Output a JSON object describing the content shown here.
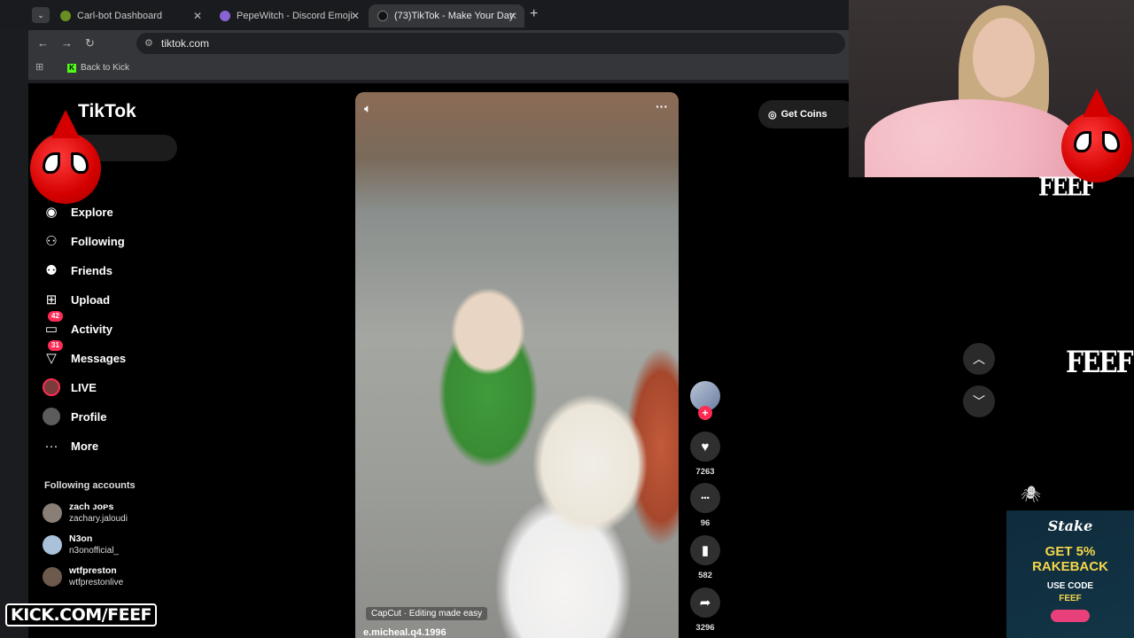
{
  "browser": {
    "tabs": [
      {
        "title": "Carl-bot Dashboard",
        "fav_color": "#6b8e23"
      },
      {
        "title": "PepeWitch - Discord Emoji",
        "fav_color": "#8a63d2"
      },
      {
        "title": "(73)TikTok - Make Your Day",
        "fav_color": "#111111"
      }
    ],
    "new_tab": "+",
    "tab_close": "✕",
    "url": "tiktok.com",
    "bookmark": "Back to Kick"
  },
  "tiktok": {
    "logo": "TikTok",
    "nav": [
      {
        "label": "Explore",
        "icon": "compass-icon",
        "glyph": "◉"
      },
      {
        "label": "Following",
        "icon": "following-icon",
        "glyph": "⚇"
      },
      {
        "label": "Friends",
        "icon": "friends-icon",
        "glyph": "⚉"
      },
      {
        "label": "Upload",
        "icon": "upload-icon",
        "glyph": "⊞"
      },
      {
        "label": "Activity",
        "icon": "activity-icon",
        "glyph": "▭",
        "badge": "42"
      },
      {
        "label": "Messages",
        "icon": "messages-icon",
        "glyph": "▽",
        "badge": "31"
      },
      {
        "label": "LIVE",
        "icon": "live-icon",
        "glyph": "●"
      },
      {
        "label": "Profile",
        "icon": "profile-icon",
        "glyph": "●"
      },
      {
        "label": "More",
        "icon": "more-icon",
        "glyph": "···"
      }
    ],
    "following_heading": "Following accounts",
    "accounts": [
      {
        "name": "zach ᴊᴏᴘs",
        "handle": "zachary.jaloudi"
      },
      {
        "name": "N3on",
        "handle": "n3onofficial_"
      },
      {
        "name": "wtfpreston",
        "handle": "wtfprestonlive"
      }
    ],
    "video": {
      "capcut": "CapCut · Editing made easy",
      "author": "e.micheal.q4.1996"
    },
    "actions": [
      {
        "icon": "heart-icon",
        "glyph": "♥",
        "count": "7263"
      },
      {
        "icon": "comment-icon",
        "glyph": "•••",
        "count": "96"
      },
      {
        "icon": "bookmark-icon",
        "glyph": "▮",
        "count": "582"
      },
      {
        "icon": "share-icon",
        "glyph": "➦",
        "count": "3296"
      }
    ],
    "get_coins": "Get Coins"
  },
  "overlay": {
    "watermark": "FEEF",
    "stake": {
      "logo": "Stake",
      "title": "GET 5% RAKEBACK",
      "use": "USE CODE",
      "code": "FEEF"
    },
    "kick_url": "KICK.COM/FEEF"
  }
}
